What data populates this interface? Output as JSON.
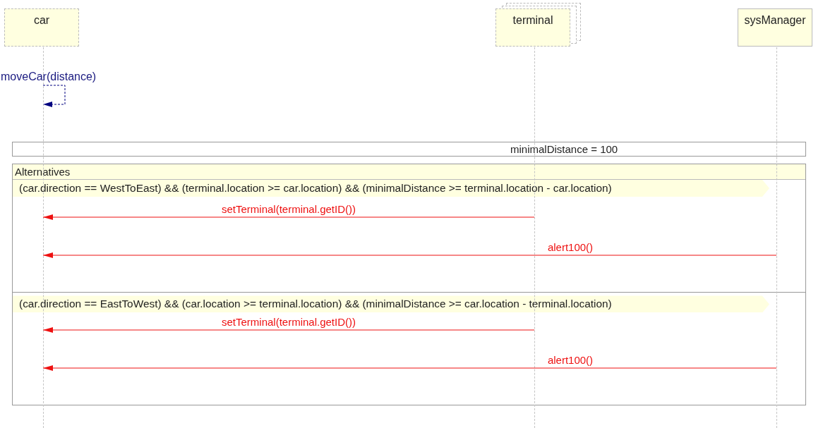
{
  "lifelines": [
    {
      "name": "car",
      "stacked": false,
      "dashed": true
    },
    {
      "name": "terminal",
      "stacked": true,
      "dashed": true
    },
    {
      "name": "sysManager",
      "stacked": false,
      "dashed": false
    }
  ],
  "self_messages": [
    {
      "label": "moveCar(distance)"
    }
  ],
  "note": {
    "text": "minimalDistance = 100"
  },
  "fragment": {
    "title": "Alternatives",
    "operands": [
      {
        "guard": "(car.direction == WestToEast) && (terminal.location >= car.location) && (minimalDistance >= terminal.location - car.location)",
        "messages": [
          {
            "label": "setTerminal(terminal.getID())"
          },
          {
            "label": "alert100()"
          }
        ]
      },
      {
        "guard": "(car.direction == EastToWest) && (car.location >= terminal.location) && (minimalDistance >= car.location - terminal.location)",
        "messages": [
          {
            "label": "setTerminal(terminal.getID())"
          },
          {
            "label": "alert100()"
          }
        ]
      }
    ]
  }
}
